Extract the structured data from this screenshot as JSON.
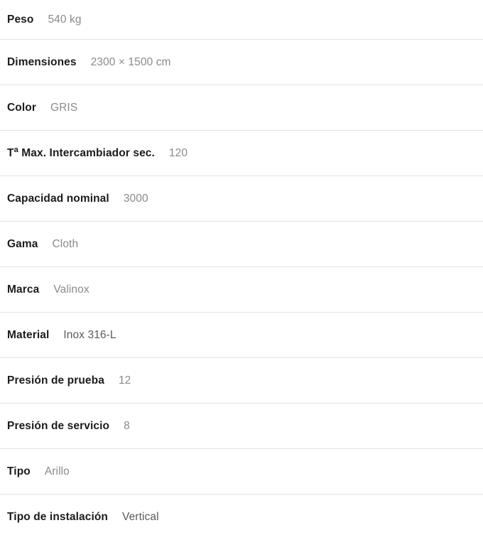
{
  "colors": {
    "background": "#ffffff",
    "label_text": "#1c1c1c",
    "value_text": "#8a8a8a",
    "value_text_dark": "#5a5a5a",
    "divider": "#e4e4e4"
  },
  "spec_table": {
    "rows": [
      {
        "label": "Peso",
        "value": "540 kg"
      },
      {
        "label": "Dimensiones",
        "value": "2300 × 1500 cm"
      },
      {
        "label": "Color",
        "value": "GRIS"
      },
      {
        "label": "Tª Max. Intercambiador sec.",
        "value": "120"
      },
      {
        "label": "Capacidad nominal",
        "value": "3000"
      },
      {
        "label": "Gama",
        "value": "Cloth"
      },
      {
        "label": "Marca",
        "value": "Valinox"
      },
      {
        "label": "Material",
        "value": "Inox 316-L"
      },
      {
        "label": "Presión de prueba",
        "value": "12"
      },
      {
        "label": "Presión de servicio",
        "value": "8"
      },
      {
        "label": "Tipo",
        "value": "Arillo"
      },
      {
        "label": "Tipo de instalación",
        "value": "Vertical"
      }
    ]
  }
}
